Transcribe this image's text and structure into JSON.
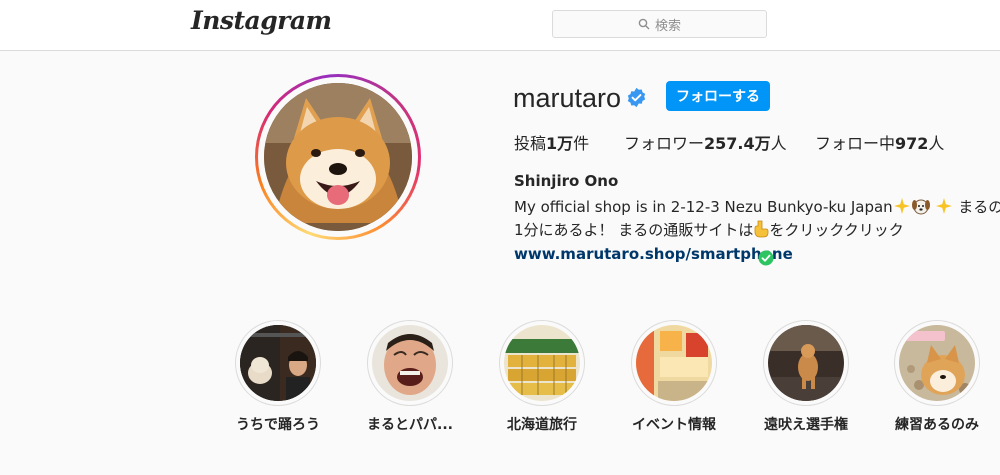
{
  "header": {
    "logo_text": "Instagram",
    "search_placeholder": "検索"
  },
  "profile": {
    "username": "marutaro",
    "follow_label": "フォローする",
    "stats": {
      "posts_label": "投稿",
      "posts_value": "1万",
      "posts_suffix": "件",
      "followers_label": "フォロワー",
      "followers_value": "257.4万",
      "followers_suffix": "人",
      "following_label": "フォロー中",
      "following_value": "972",
      "following_suffix": "人"
    },
    "full_name": "Shinjiro Ono",
    "bio_line1": "My official shop is in 2-12-3 Nezu Bunkyo-ku Japan",
    "bio_line1_end": "まるのあ",
    "bio_line2_a": "1分にあるよ！ まるの通販サイトは",
    "bio_line2_b": "をクリッククリック",
    "website": "www.marutaro.shop/smartphone"
  },
  "highlights": [
    {
      "label": "うちで踊ろう"
    },
    {
      "label": "まるとパパ..."
    },
    {
      "label": "北海道旅行"
    },
    {
      "label": "イベント情報"
    },
    {
      "label": "遠吠え選手権"
    },
    {
      "label": "練習あるのみ"
    }
  ],
  "colors": {
    "accent": "#0095f6",
    "verified": "#3897f0",
    "link": "#00376b"
  }
}
